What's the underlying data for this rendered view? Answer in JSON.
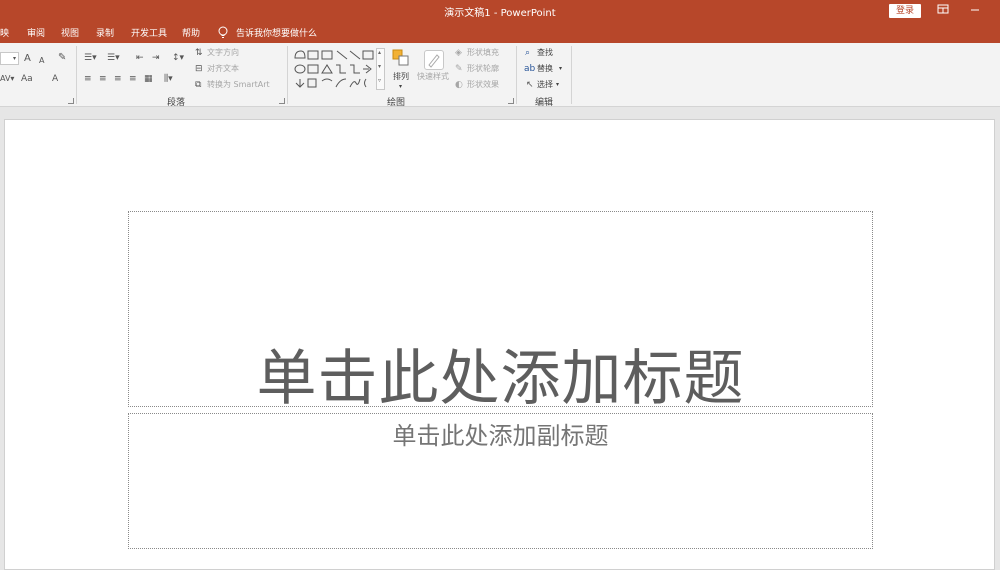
{
  "window": {
    "title": "演示文稿1 - PowerPoint",
    "login_label": "登录",
    "icons": [
      "ribbon-display-options-icon",
      "minimize-icon"
    ]
  },
  "menu": {
    "items": [
      "映",
      "审阅",
      "视图",
      "录制",
      "开发工具",
      "帮助"
    ],
    "tell_me": "告诉我你想要做什么"
  },
  "ribbon": {
    "font_group": {
      "size_value": "",
      "grow_label": "A",
      "shrink_label": "A",
      "case_label": "Aa",
      "color_label": "A"
    },
    "paragraph_group": {
      "label": "段落",
      "text_direction": "文字方向",
      "align_text": "对齐文本",
      "convert_smartart": "转换为 SmartArt"
    },
    "drawing_group": {
      "label": "绘图",
      "arrange": "排列",
      "quick_styles": "快速样式",
      "shape_fill": "形状填充",
      "shape_outline": "形状轮廓",
      "shape_effects": "形状效果"
    },
    "editing_group": {
      "label": "编辑",
      "find": "查找",
      "replace": "替换",
      "select": "选择"
    }
  },
  "slide": {
    "title_placeholder": "单击此处添加标题",
    "subtitle_placeholder": "单击此处添加副标题"
  },
  "colors": {
    "accent": "#b7472a",
    "ribbon_bg": "#f3f3f3",
    "canvas_bg": "#e6e6e6"
  }
}
